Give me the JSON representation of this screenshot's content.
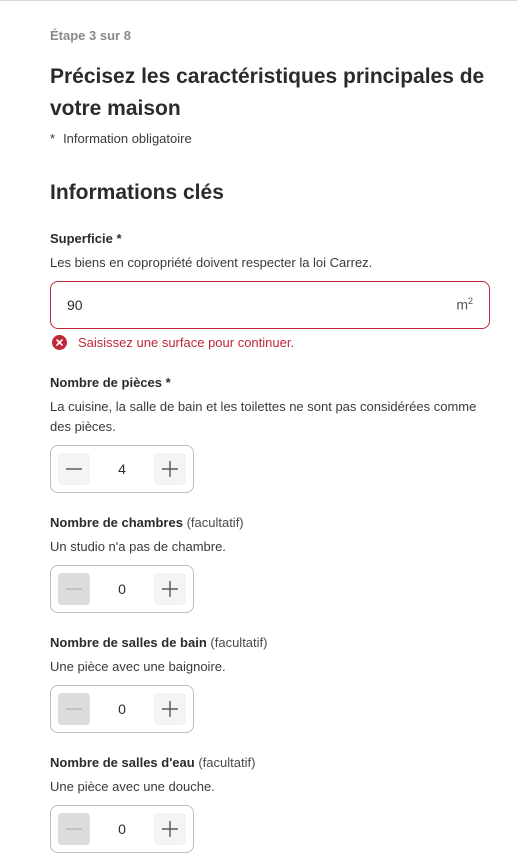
{
  "step_indicator": "Étape 3 sur 8",
  "page_title": "Précisez les caractéristiques principales de votre maison",
  "required_note": {
    "star": "*",
    "text": "Information obligatoire"
  },
  "section_title": "Informations clés",
  "surface": {
    "label": "Superficie *",
    "help": "Les biens en copropriété doivent respecter la loi Carrez.",
    "value": "90",
    "unit": "m",
    "unit_exp": "2",
    "error_icon": "error-circle-icon",
    "error_text": "Saisissez une surface pour continuer."
  },
  "rooms": {
    "label": "Nombre de pièces *",
    "help": "La cuisine, la salle de bain et les toilettes ne sont pas considérées comme des pièces.",
    "value": "4"
  },
  "bedrooms": {
    "label": "Nombre de chambres",
    "optional": "(facultatif)",
    "help": "Un studio n'a pas de chambre.",
    "value": "0"
  },
  "bathrooms": {
    "label": "Nombre de salles de bain",
    "optional": "(facultatif)",
    "help": "Une pièce avec une baignoire.",
    "value": "0"
  },
  "shower_rooms": {
    "label": "Nombre de salles d'eau",
    "optional": "(facultatif)",
    "help": "Une pièce avec une douche.",
    "value": "0"
  },
  "colors": {
    "error": "#c0283a",
    "text": "#2b2b2b",
    "muted": "#8a8a8a"
  }
}
